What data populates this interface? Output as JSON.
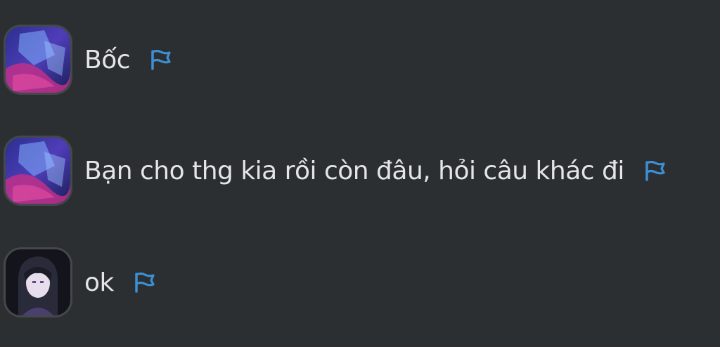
{
  "messages": [
    {
      "avatar": "anime-avatar-blue",
      "text": "Bốc",
      "action_icon": "flag-icon"
    },
    {
      "avatar": "anime-avatar-blue",
      "text": "Bạn cho thg kia rồi còn đâu, hỏi câu khác đi",
      "action_icon": "flag-icon"
    },
    {
      "avatar": "anime-avatar-dark-hair",
      "text": "ok",
      "action_icon": "flag-icon"
    }
  ],
  "colors": {
    "background": "#2b2f31",
    "text": "#e3e5e6",
    "flag": "#3d8fd6"
  }
}
